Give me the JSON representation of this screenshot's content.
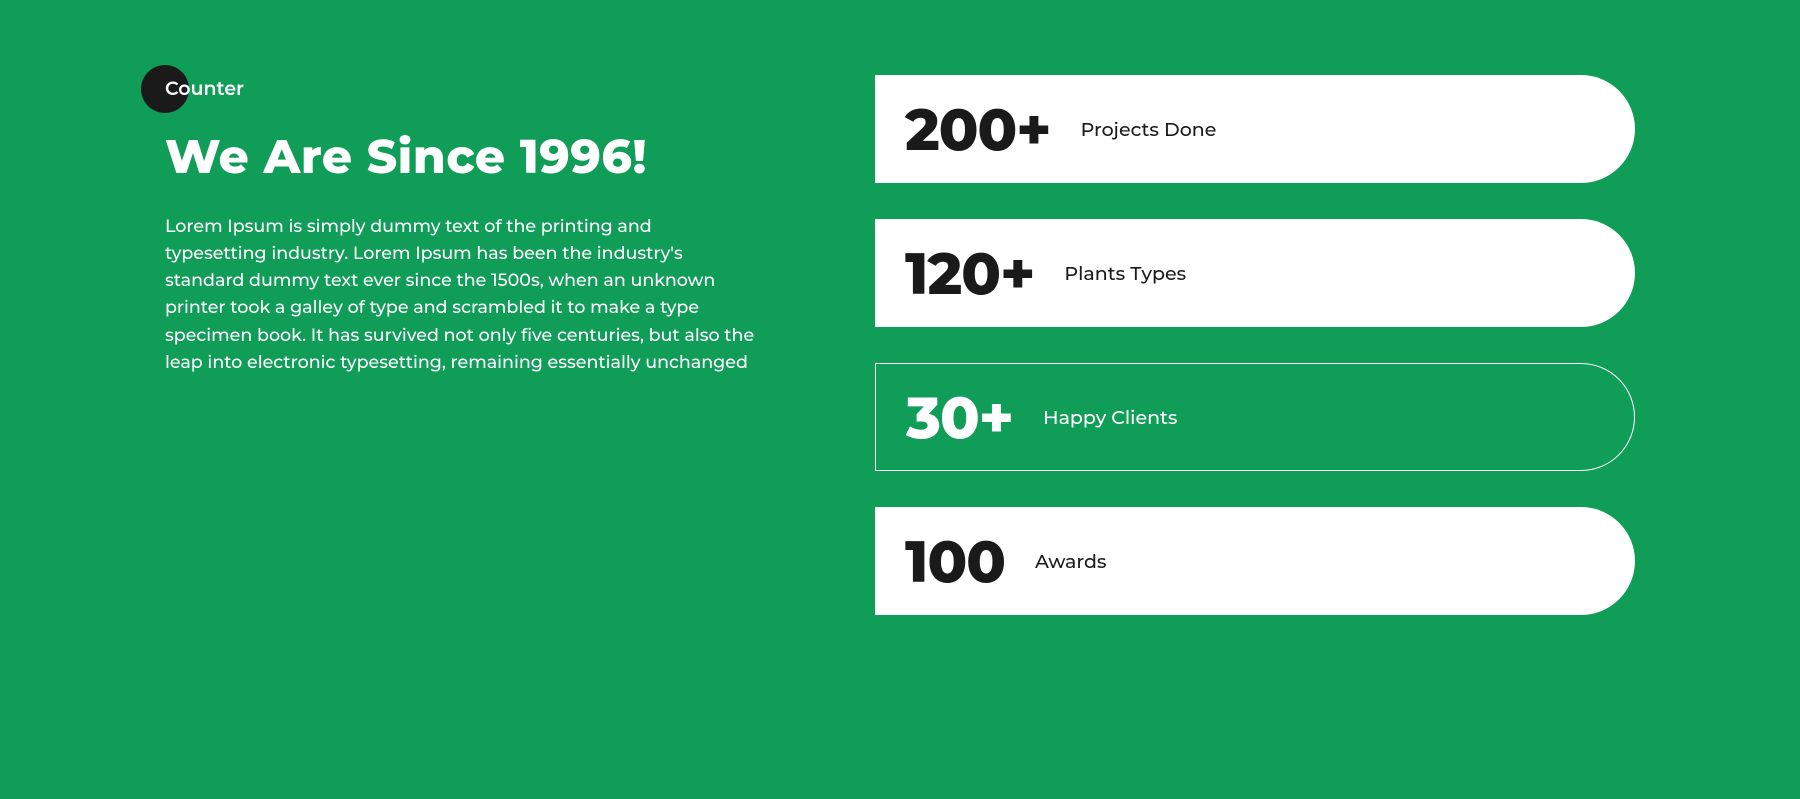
{
  "section": {
    "badge": "Counter",
    "heading": "We Are Since 1996!",
    "description": "Lorem Ipsum is simply dummy text of the printing and typesetting industry. Lorem Ipsum has been the industry's standard dummy text ever since the 1500s, when an unknown printer took a galley of type and scrambled it to make a type specimen book. It has survived not only five centuries, but also the leap into electronic typesetting, remaining essentially unchanged"
  },
  "counters": [
    {
      "value": "200+",
      "label": "Projects Done",
      "outlined": false
    },
    {
      "value": "120+",
      "label": "Plants Types",
      "outlined": false
    },
    {
      "value": "30+",
      "label": "Happy Clients",
      "outlined": true
    },
    {
      "value": "100",
      "label": "Awards",
      "outlined": false
    }
  ]
}
